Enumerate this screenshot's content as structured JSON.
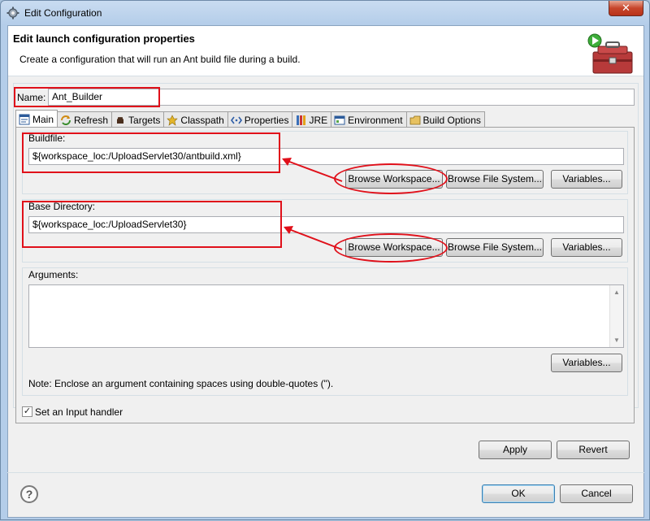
{
  "window": {
    "title": "Edit Configuration",
    "close_glyph": "✕"
  },
  "header": {
    "title": "Edit launch configuration properties",
    "subtitle": "Create a configuration that will run an Ant build file during a build.",
    "logo_icon": "ant-toolbox-run-icon"
  },
  "name_field": {
    "label": "Name:",
    "value": "Ant_Builder"
  },
  "tabs": [
    {
      "label": "Main",
      "icon": "main-tab-icon",
      "active": true
    },
    {
      "label": "Refresh",
      "icon": "refresh-icon"
    },
    {
      "label": "Targets",
      "icon": "targets-icon"
    },
    {
      "label": "Classpath",
      "icon": "classpath-icon"
    },
    {
      "label": "Properties",
      "icon": "properties-icon"
    },
    {
      "label": "JRE",
      "icon": "jre-icon"
    },
    {
      "label": "Environment",
      "icon": "environment-icon"
    },
    {
      "label": "Build Options",
      "icon": "build-options-icon"
    }
  ],
  "buildfile": {
    "label": "Buildfile:",
    "value": "${workspace_loc:/UploadServlet30/antbuild.xml}",
    "browse_workspace": "Browse Workspace...",
    "browse_filesystem": "Browse File System...",
    "variables": "Variables..."
  },
  "base_directory": {
    "label": "Base Directory:",
    "value": "${workspace_loc:/UploadServlet30}",
    "browse_workspace": "Browse Workspace...",
    "browse_filesystem": "Browse File System...",
    "variables": "Variables..."
  },
  "arguments": {
    "label": "Arguments:",
    "value": "",
    "variables": "Variables...",
    "note": "Note: Enclose an argument containing spaces using double-quotes (\")."
  },
  "input_handler": {
    "label": "Set an Input handler",
    "checked": true,
    "check_glyph": "✓"
  },
  "actions": {
    "apply": "Apply",
    "revert": "Revert",
    "ok": "OK",
    "cancel": "Cancel",
    "help_glyph": "?"
  },
  "colors": {
    "annotation_red": "#e0101a",
    "accent": "#3c7fb1"
  }
}
